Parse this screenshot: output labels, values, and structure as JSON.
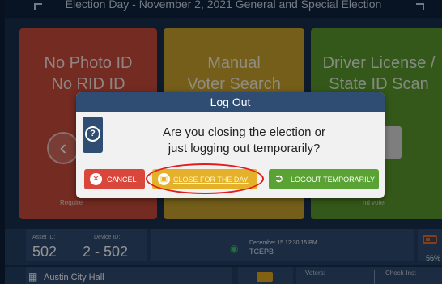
{
  "header": {
    "title": "Election Day - November 2, 2021 General and Special Election"
  },
  "tiles": [
    {
      "line1": "No Photo ID",
      "line2": "No RID ID",
      "note": "Require",
      "color": "#c94a3a"
    },
    {
      "line1": "Manual",
      "line2": "Voter Search",
      "color": "#c9a22b"
    },
    {
      "line1": "Driver License /",
      "line2": "State ID Scan",
      "note": "nd voter",
      "color": "#5a982c"
    }
  ],
  "status": {
    "asset_label": "Asset ID:",
    "asset_value": "502",
    "device_label": "Device ID:",
    "device_value": "2 - 502",
    "datetime": "December 15  12:30:15 PM",
    "site_code": "TCEPB",
    "battery": "56%"
  },
  "bottom": {
    "location": "Austin City Hall",
    "voters_label": "Voters:",
    "checkins_label": "Check-Ins:"
  },
  "modal": {
    "title": "Log Out",
    "question_line1": "Are you closing the election or",
    "question_line2": "just logging out temporarily?",
    "cancel_label": "CANCEL",
    "close_label": "CLOSE FOR THE DAY",
    "logout_label": "LOGOUT TEMPORARILY"
  },
  "icons": {
    "help": "question-circle-icon",
    "cancel": "x-circle-icon",
    "close": "lock-icon",
    "logout": "logout-icon",
    "wifi": "wifi-icon",
    "battery": "battery-icon",
    "map": "map-icon",
    "printer": "printer-icon"
  },
  "colors": {
    "cancel": "#d9463b",
    "close": "#e5b02a",
    "logout": "#5aa233",
    "header": "#2f4c73",
    "highlight_circle": "#e21c1c"
  }
}
